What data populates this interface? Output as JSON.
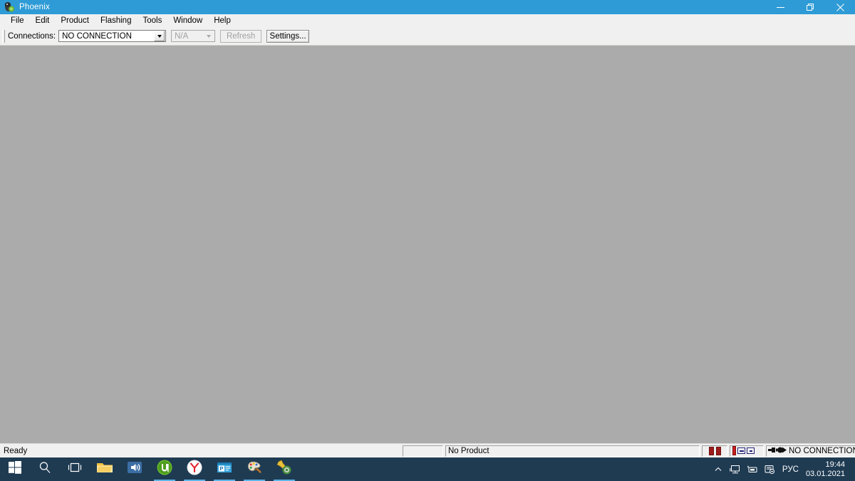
{
  "window": {
    "title": "Phoenix",
    "icon": "phoenix-app-icon",
    "controls": {
      "minimize": "minimize-button",
      "restore": "restore-button",
      "close": "close-button"
    },
    "title_bar_color": "#2e9bd6",
    "client_color": "#ababab"
  },
  "menu": {
    "items": [
      {
        "label": "File"
      },
      {
        "label": "Edit"
      },
      {
        "label": "Product"
      },
      {
        "label": "Flashing"
      },
      {
        "label": "Tools"
      },
      {
        "label": "Window"
      },
      {
        "label": "Help"
      }
    ]
  },
  "toolbar": {
    "connections_label": "Connections:",
    "connection_value": "NO CONNECTION",
    "secondary_value": "N/A",
    "refresh_label": "Refresh",
    "settings_label": "Settings..."
  },
  "status_bar": {
    "ready_text": "Ready",
    "blank_panel": "",
    "product_text": "No Product",
    "connection_text": "NO CONNECTION"
  },
  "taskbar": {
    "items": [
      {
        "name": "start-button",
        "icon": "windows-logo-icon",
        "running": false
      },
      {
        "name": "search-button",
        "icon": "search-icon",
        "running": false
      },
      {
        "name": "task-view-button",
        "icon": "task-view-icon",
        "running": false
      },
      {
        "name": "file-explorer-button",
        "icon": "folder-icon",
        "running": false
      },
      {
        "name": "volume-app-button",
        "icon": "speaker-icon",
        "running": false
      },
      {
        "name": "utorrent-button",
        "icon": "utorrent-icon",
        "running": true
      },
      {
        "name": "yandex-browser-button",
        "icon": "yandex-icon",
        "running": true
      },
      {
        "name": "office-app-button",
        "icon": "office-document-icon",
        "running": true
      },
      {
        "name": "paint-button",
        "icon": "paint-palette-icon",
        "running": true
      },
      {
        "name": "tools-app-button",
        "icon": "wrench-gear-icon",
        "running": true
      }
    ],
    "tray": {
      "overflow": "chevron-up-icon",
      "network": "network-monitor-icon",
      "unknown": "device-icon",
      "action_center": "action-center-icon",
      "language": "РУС",
      "time": "19:44",
      "date": "03.01.2021"
    }
  }
}
